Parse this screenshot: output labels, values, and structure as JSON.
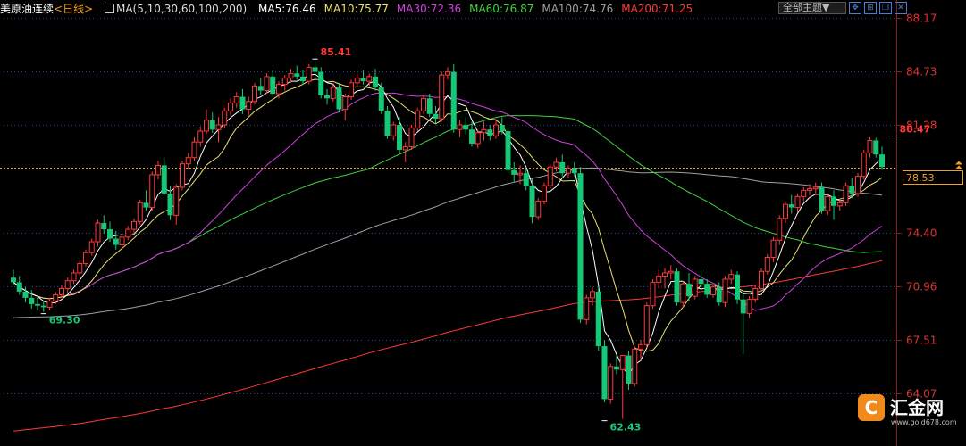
{
  "header": {
    "symbol": "美原油连续",
    "period": "<日线>",
    "ma_params": "MA(5,10,30,60,100,200)",
    "ma_values": [
      {
        "label": "MA5:76.46",
        "color": "#ffffff"
      },
      {
        "label": "MA10:75.77",
        "color": "#e8e070"
      },
      {
        "label": "MA30:72.36",
        "color": "#d040e0"
      },
      {
        "label": "MA60:76.87",
        "color": "#40d040"
      },
      {
        "label": "MA100:74.76",
        "color": "#a0a0a0"
      },
      {
        "label": "MA200:71.25",
        "color": "#ff3838"
      }
    ]
  },
  "toolbar": {
    "theme_label": "全部主题▼",
    "icons": [
      "expand-icon",
      "crosshair-icon",
      "restore-icon",
      "close-icon"
    ]
  },
  "current_price": "78.53",
  "logo": {
    "mark": "C",
    "name": "汇金网",
    "url": "www.gold678.com"
  },
  "chart_data": {
    "type": "candlestick",
    "ylim": [
      64.07,
      88.17
    ],
    "yticks": [
      "88.17",
      "84.73",
      "81.28",
      "74.40",
      "70.96",
      "67.51",
      "64.07"
    ],
    "current_price": 78.53,
    "annotations": [
      {
        "label": "85.41",
        "value": 85.41,
        "candle": 50,
        "kind": "high"
      },
      {
        "label": "69.30",
        "value": 69.3,
        "candle": 5,
        "kind": "low"
      },
      {
        "label": "80.47",
        "value": 80.47,
        "candle": 146,
        "kind": "high"
      },
      {
        "label": "62.43",
        "value": 62.43,
        "candle": 98,
        "kind": "low"
      }
    ],
    "colors": {
      "up": "#ff3838",
      "down": "#14c878",
      "ma5": "#ffffff",
      "ma10": "#e8e070",
      "ma30": "#d040e0",
      "ma60": "#40d040",
      "ma100": "#a0a0a0",
      "ma200": "#ff3838"
    },
    "candles": [
      [
        71.5,
        72.0,
        71.0,
        71.2
      ],
      [
        71.2,
        71.6,
        70.4,
        70.6
      ],
      [
        70.6,
        70.9,
        69.9,
        70.2
      ],
      [
        70.2,
        70.7,
        69.5,
        69.8
      ],
      [
        69.8,
        70.3,
        69.4,
        69.7
      ],
      [
        69.7,
        70.0,
        69.3,
        69.6
      ],
      [
        69.6,
        70.2,
        69.4,
        70.0
      ],
      [
        70.0,
        70.6,
        69.8,
        70.4
      ],
      [
        70.4,
        71.0,
        70.2,
        70.8
      ],
      [
        70.8,
        71.5,
        70.5,
        71.3
      ],
      [
        71.3,
        72.0,
        71.1,
        71.8
      ],
      [
        71.8,
        72.6,
        71.6,
        72.4
      ],
      [
        72.4,
        73.3,
        72.2,
        73.1
      ],
      [
        73.1,
        74.0,
        72.9,
        73.8
      ],
      [
        73.8,
        75.2,
        73.5,
        75.0
      ],
      [
        75.0,
        75.5,
        74.3,
        74.6
      ],
      [
        74.6,
        75.1,
        73.8,
        74.0
      ],
      [
        74.0,
        74.5,
        73.3,
        73.6
      ],
      [
        73.6,
        74.3,
        73.4,
        74.1
      ],
      [
        74.1,
        74.8,
        73.9,
        74.6
      ],
      [
        74.6,
        75.3,
        74.3,
        75.1
      ],
      [
        75.1,
        76.5,
        74.9,
        76.3
      ],
      [
        76.3,
        77.1,
        75.8,
        76.0
      ],
      [
        76.0,
        78.3,
        75.8,
        78.1
      ],
      [
        78.1,
        79.0,
        77.8,
        78.7
      ],
      [
        78.7,
        79.2,
        76.8,
        76.9
      ],
      [
        76.9,
        77.4,
        75.2,
        75.5
      ],
      [
        75.5,
        77.5,
        74.9,
        77.3
      ],
      [
        77.3,
        79.0,
        77.1,
        78.8
      ],
      [
        78.8,
        79.5,
        78.5,
        79.2
      ],
      [
        79.2,
        80.5,
        79.0,
        80.2
      ],
      [
        80.2,
        81.2,
        79.9,
        80.9
      ],
      [
        80.9,
        82.3,
        80.7,
        81.6
      ],
      [
        81.6,
        82.1,
        80.8,
        81.0
      ],
      [
        81.0,
        81.8,
        80.2,
        81.3
      ],
      [
        81.3,
        82.4,
        81.1,
        82.2
      ],
      [
        82.2,
        83.0,
        81.9,
        82.7
      ],
      [
        82.7,
        83.4,
        82.4,
        83.1
      ],
      [
        83.1,
        83.6,
        82.0,
        82.3
      ],
      [
        82.3,
        83.1,
        81.9,
        82.8
      ],
      [
        82.8,
        84.0,
        82.6,
        83.8
      ],
      [
        83.8,
        84.3,
        83.2,
        83.5
      ],
      [
        83.5,
        84.6,
        83.3,
        84.4
      ],
      [
        84.4,
        84.8,
        83.1,
        83.3
      ],
      [
        83.3,
        84.1,
        83.0,
        83.9
      ],
      [
        83.9,
        84.5,
        83.5,
        84.3
      ],
      [
        84.3,
        84.9,
        84.0,
        84.6
      ],
      [
        84.6,
        85.1,
        84.2,
        84.4
      ],
      [
        84.4,
        84.8,
        83.9,
        84.1
      ],
      [
        84.1,
        85.2,
        83.9,
        85.0
      ],
      [
        85.0,
        85.41,
        84.5,
        84.7
      ],
      [
        84.7,
        85.0,
        83.0,
        83.2
      ],
      [
        83.2,
        83.6,
        82.6,
        83.0
      ],
      [
        83.0,
        83.9,
        82.8,
        83.7
      ],
      [
        83.7,
        84.0,
        82.1,
        82.3
      ],
      [
        82.3,
        83.3,
        81.6,
        83.1
      ],
      [
        83.1,
        84.2,
        82.9,
        84.0
      ],
      [
        84.0,
        84.6,
        83.7,
        84.3
      ],
      [
        84.3,
        84.8,
        83.9,
        84.1
      ],
      [
        84.1,
        84.6,
        83.8,
        84.4
      ],
      [
        84.4,
        84.9,
        83.5,
        83.7
      ],
      [
        83.7,
        84.0,
        82.0,
        82.2
      ],
      [
        82.2,
        82.5,
        80.4,
        80.6
      ],
      [
        80.6,
        81.5,
        80.3,
        81.3
      ],
      [
        81.3,
        81.8,
        79.5,
        79.7
      ],
      [
        79.7,
        80.2,
        78.9,
        79.9
      ],
      [
        79.9,
        81.3,
        79.7,
        81.1
      ],
      [
        81.1,
        82.4,
        80.9,
        82.2
      ],
      [
        82.2,
        83.2,
        82.0,
        83.0
      ],
      [
        83.0,
        83.3,
        81.8,
        82.0
      ],
      [
        82.0,
        82.5,
        81.4,
        81.7
      ],
      [
        81.7,
        84.7,
        81.5,
        84.5
      ],
      [
        84.5,
        85.0,
        84.2,
        84.7
      ],
      [
        84.7,
        85.2,
        80.8,
        81.0
      ],
      [
        81.0,
        81.6,
        80.5,
        81.3
      ],
      [
        81.3,
        81.8,
        80.7,
        81.0
      ],
      [
        81.0,
        81.5,
        79.9,
        80.1
      ],
      [
        80.1,
        81.0,
        79.8,
        80.8
      ],
      [
        80.8,
        81.5,
        80.3,
        81.0
      ],
      [
        81.0,
        81.3,
        80.3,
        80.6
      ],
      [
        80.6,
        81.6,
        80.4,
        81.3
      ],
      [
        81.3,
        81.8,
        80.7,
        80.9
      ],
      [
        80.9,
        81.2,
        78.2,
        78.4
      ],
      [
        78.4,
        78.9,
        77.6,
        78.1
      ],
      [
        78.1,
        78.7,
        77.5,
        78.2
      ],
      [
        78.2,
        78.6,
        77.1,
        77.4
      ],
      [
        77.4,
        77.9,
        75.0,
        75.4
      ],
      [
        75.4,
        76.6,
        75.2,
        76.4
      ],
      [
        76.4,
        77.6,
        76.2,
        77.4
      ],
      [
        77.4,
        78.8,
        77.2,
        78.6
      ],
      [
        78.6,
        79.2,
        78.3,
        78.9
      ],
      [
        78.9,
        79.4,
        78.0,
        78.2
      ],
      [
        78.2,
        78.7,
        77.9,
        78.5
      ],
      [
        78.5,
        78.9,
        78.0,
        78.2
      ],
      [
        78.2,
        78.6,
        68.6,
        68.8
      ],
      [
        68.8,
        70.4,
        68.5,
        70.2
      ],
      [
        70.2,
        70.9,
        69.7,
        70.6
      ],
      [
        70.6,
        70.9,
        66.8,
        67.1
      ],
      [
        67.1,
        67.5,
        63.5,
        63.7
      ],
      [
        63.7,
        66.0,
        63.4,
        65.8
      ],
      [
        65.8,
        66.5,
        65.3,
        65.6
      ],
      [
        65.6,
        65.9,
        62.43,
        66.5
      ],
      [
        66.5,
        66.8,
        64.3,
        64.7
      ],
      [
        64.7,
        67.1,
        64.5,
        66.9
      ],
      [
        66.9,
        67.5,
        66.2,
        67.2
      ],
      [
        67.2,
        69.9,
        67.0,
        69.7
      ],
      [
        69.7,
        71.4,
        69.5,
        71.2
      ],
      [
        71.2,
        72.0,
        70.8,
        71.6
      ],
      [
        71.6,
        72.1,
        70.8,
        71.8
      ],
      [
        71.8,
        72.3,
        71.4,
        71.9
      ],
      [
        71.9,
        72.1,
        69.7,
        69.9
      ],
      [
        69.9,
        71.3,
        69.6,
        71.1
      ],
      [
        71.1,
        71.8,
        70.0,
        70.3
      ],
      [
        70.3,
        71.6,
        70.1,
        71.4
      ],
      [
        71.4,
        72.0,
        70.9,
        71.1
      ],
      [
        71.1,
        71.4,
        70.2,
        70.4
      ],
      [
        70.4,
        71.1,
        70.2,
        70.9
      ],
      [
        70.9,
        71.2,
        69.7,
        69.9
      ],
      [
        69.9,
        71.6,
        69.6,
        71.4
      ],
      [
        71.4,
        72.0,
        71.1,
        71.7
      ],
      [
        71.7,
        71.9,
        69.8,
        70.1
      ],
      [
        70.1,
        70.5,
        66.6,
        69.2
      ],
      [
        69.2,
        70.3,
        68.9,
        70.1
      ],
      [
        70.1,
        71.0,
        69.9,
        70.8
      ],
      [
        70.8,
        72.1,
        70.6,
        71.9
      ],
      [
        71.9,
        73.0,
        71.7,
        72.8
      ],
      [
        72.8,
        74.1,
        72.5,
        73.9
      ],
      [
        73.9,
        75.5,
        73.6,
        75.3
      ],
      [
        75.3,
        76.4,
        75.0,
        76.2
      ],
      [
        76.2,
        76.8,
        75.6,
        76.0
      ],
      [
        76.0,
        76.9,
        75.7,
        76.7
      ],
      [
        76.7,
        77.3,
        76.4,
        77.1
      ],
      [
        77.1,
        77.5,
        76.8,
        77.2
      ],
      [
        77.2,
        77.6,
        76.9,
        77.3
      ],
      [
        77.3,
        77.6,
        75.6,
        75.8
      ],
      [
        75.8,
        76.9,
        75.5,
        76.7
      ],
      [
        76.7,
        77.1,
        75.2,
        76.1
      ],
      [
        76.1,
        76.5,
        75.8,
        76.3
      ],
      [
        76.3,
        77.6,
        76.1,
        77.4
      ],
      [
        77.4,
        77.9,
        76.6,
        76.9
      ],
      [
        76.9,
        78.2,
        76.7,
        78.0
      ],
      [
        78.0,
        79.7,
        77.8,
        79.5
      ],
      [
        79.5,
        80.5,
        79.2,
        80.3
      ],
      [
        80.3,
        80.47,
        79.2,
        79.4
      ],
      [
        79.4,
        79.9,
        78.4,
        78.6
      ]
    ]
  }
}
